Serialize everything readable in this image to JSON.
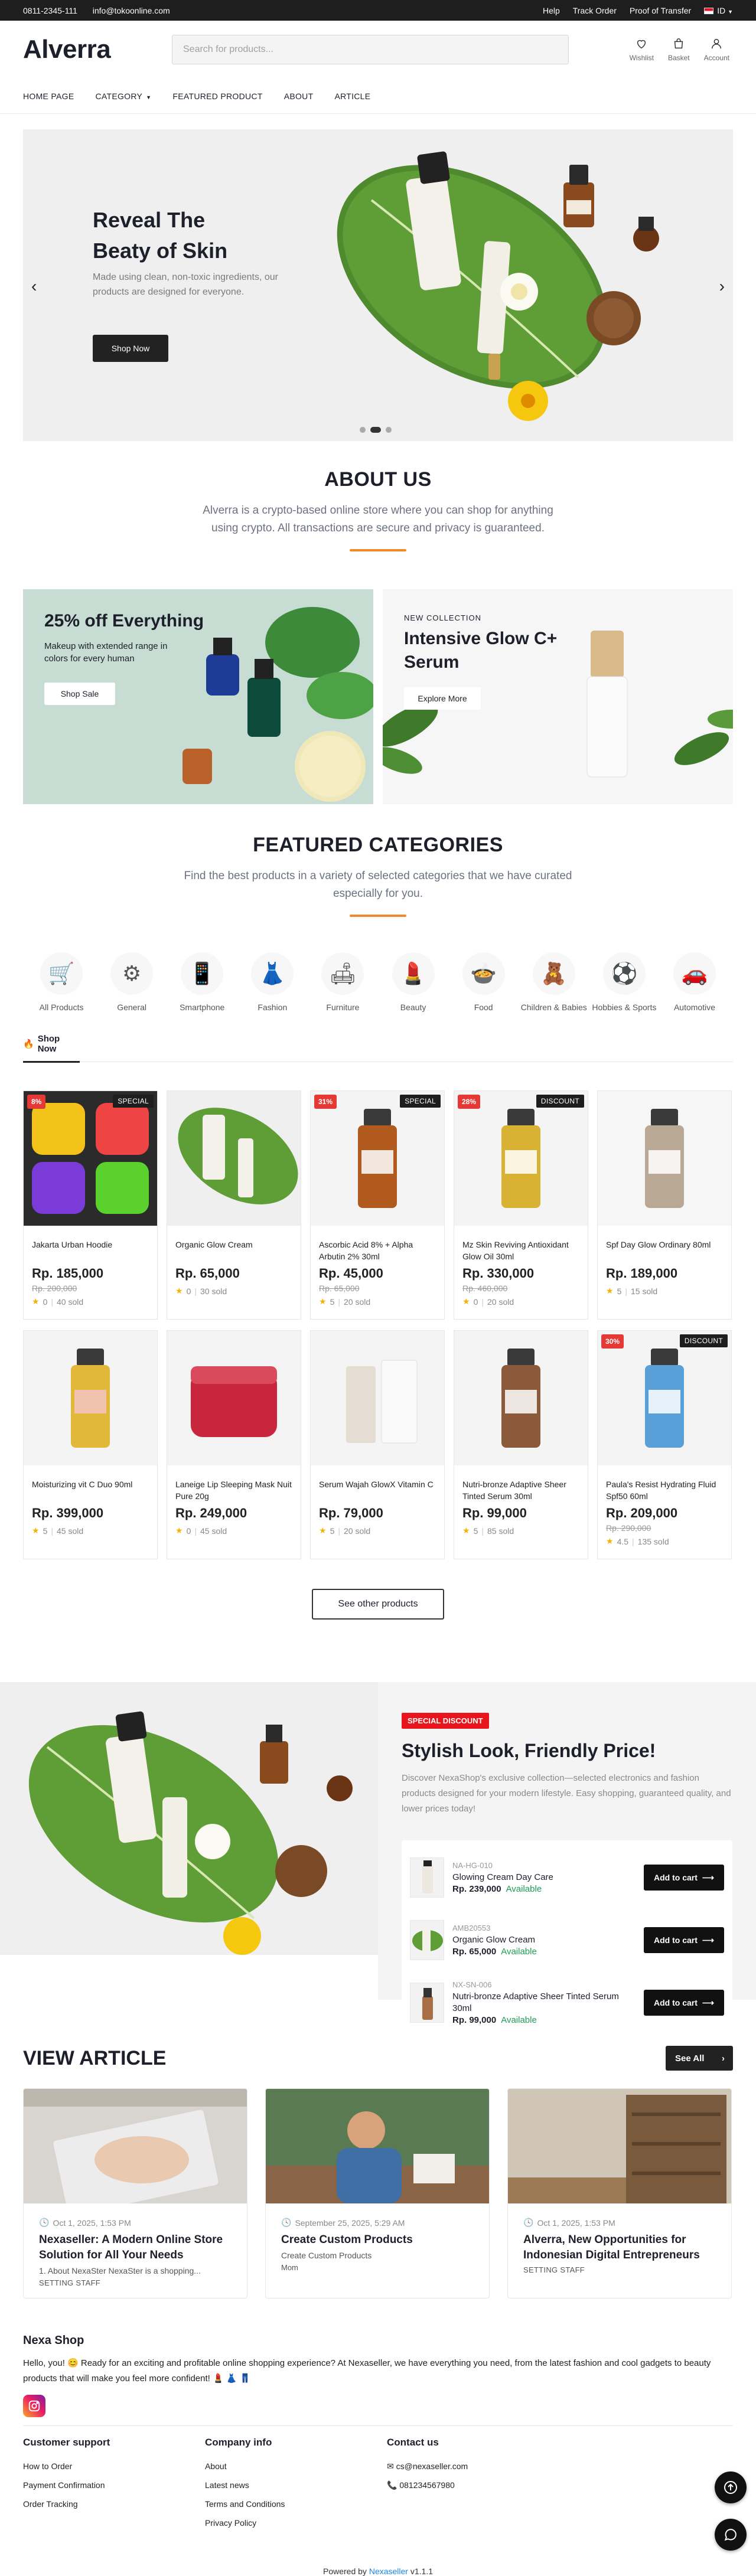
{
  "topbar": {
    "phone": "0811-2345-111",
    "email": "info@tokoonline.com",
    "links": [
      "Help",
      "Track Order",
      "Proof of Transfer"
    ],
    "lang": "ID"
  },
  "header": {
    "logo": "Alverra",
    "search_placeholder": "Search for products...",
    "icons": [
      {
        "label": "Wishlist",
        "icon": "heart-icon"
      },
      {
        "label": "Basket",
        "icon": "bag-icon"
      },
      {
        "label": "Account",
        "icon": "user-icon"
      }
    ]
  },
  "nav": [
    "HOME PAGE",
    "CATEGORY",
    "FEATURED PRODUCT",
    "ABOUT",
    "ARTICLE"
  ],
  "hero": {
    "title_line1": "Reveal The",
    "title_line2": "Beaty of Skin",
    "desc": "Made using clean, non-toxic ingredients, our products are designed for everyone.",
    "button": "Shop Now",
    "slide_index": 2,
    "slide_count": 3
  },
  "about": {
    "title": "ABOUT US",
    "desc": "Alverra is a crypto-based online store where you can shop for anything using crypto. All transactions are secure and privacy is guaranteed."
  },
  "promos": [
    {
      "title": "25% off Everything",
      "desc": "Makeup with extended range in colors for every human",
      "button": "Shop Sale"
    },
    {
      "eyebrow": "NEW COLLECTION",
      "title": "Intensive Glow C+ Serum",
      "button": "Explore More"
    }
  ],
  "categories": {
    "title": "FEATURED CATEGORIES",
    "desc": "Find the best products in a variety of selected categories that we have curated especially for you.",
    "items": [
      {
        "label": "All Products",
        "icon": "🛒"
      },
      {
        "label": "General",
        "icon": "⚙"
      },
      {
        "label": "Smartphone",
        "icon": "📱"
      },
      {
        "label": "Fashion",
        "icon": "👗"
      },
      {
        "label": "Furniture",
        "icon": "🛋"
      },
      {
        "label": "Beauty",
        "icon": "💄"
      },
      {
        "label": "Food",
        "icon": "🍲"
      },
      {
        "label": "Children & Babies",
        "icon": "🧸"
      },
      {
        "label": "Hobbies & Sports",
        "icon": "⚽"
      },
      {
        "label": "Automotive",
        "icon": "🚗"
      }
    ]
  },
  "shop_tab": "Shop Now",
  "products": [
    {
      "name": "Jakarta Urban Hoodie",
      "price": "Rp. 185,000",
      "old": "Rp. 200,000",
      "rating": "0",
      "sold": "40 sold",
      "pct": "8%",
      "tag": "SPECIAL"
    },
    {
      "name": "Organic Glow Cream",
      "price": "Rp. 65,000",
      "old": "",
      "rating": "0",
      "sold": "30 sold",
      "pct": "",
      "tag": ""
    },
    {
      "name": "Ascorbic Acid 8% + Alpha Arbutin 2% 30ml",
      "price": "Rp. 45,000",
      "old": "Rp. 65,000",
      "rating": "5",
      "sold": "20 sold",
      "pct": "31%",
      "tag": "SPECIAL"
    },
    {
      "name": "Mz Skin Reviving Antioxidant Glow Oil 30ml",
      "price": "Rp. 330,000",
      "old": "Rp. 460,000",
      "rating": "0",
      "sold": "20 sold",
      "pct": "28%",
      "tag": "DISCOUNT"
    },
    {
      "name": "Spf Day Glow Ordinary 80ml",
      "price": "Rp. 189,000",
      "old": "",
      "rating": "5",
      "sold": "15 sold",
      "pct": "",
      "tag": ""
    },
    {
      "name": "Moisturizing vit C Duo 90ml",
      "price": "Rp. 399,000",
      "old": "",
      "rating": "5",
      "sold": "45 sold",
      "pct": "",
      "tag": ""
    },
    {
      "name": "Laneige Lip Sleeping Mask Nuit Pure 20g",
      "price": "Rp. 249,000",
      "old": "",
      "rating": "0",
      "sold": "45 sold",
      "pct": "",
      "tag": ""
    },
    {
      "name": "Serum Wajah GlowX Vitamin C",
      "price": "Rp. 79,000",
      "old": "",
      "rating": "5",
      "sold": "20 sold",
      "pct": "",
      "tag": ""
    },
    {
      "name": "Nutri-bronze Adaptive Sheer Tinted Serum 30ml",
      "price": "Rp. 99,000",
      "old": "",
      "rating": "5",
      "sold": "85 sold",
      "pct": "",
      "tag": ""
    },
    {
      "name": "Paula's Resist Hydrating Fluid Spf50 60ml",
      "price": "Rp. 209,000",
      "old": "Rp. 290,000",
      "rating": "4.5",
      "sold": "135 sold",
      "pct": "30%",
      "tag": "DISCOUNT"
    }
  ],
  "see_other": "See other products",
  "special": {
    "badge": "SPECIAL DISCOUNT",
    "title": "Stylish Look, Friendly Price!",
    "desc": "Discover NexaShop's exclusive collection—selected electronics and fashion products designed for your modern lifestyle. Easy shopping, guaranteed quality, and lower prices today!",
    "items": [
      {
        "code": "NA-HG-010",
        "name": "Glowing Cream Day Care",
        "price": "Rp. 239,000",
        "avail": "Available",
        "button": "Add to cart"
      },
      {
        "code": "AMB20553",
        "name": "Organic Glow Cream",
        "price": "Rp. 65,000",
        "avail": "Available",
        "button": "Add to cart"
      },
      {
        "code": "NX-SN-006",
        "name": "Nutri-bronze Adaptive Sheer Tinted Serum 30ml",
        "price": "Rp. 99,000",
        "avail": "Available",
        "button": "Add to cart"
      }
    ]
  },
  "articles": {
    "title": "VIEW ARTICLE",
    "see_all": "See All",
    "items": [
      {
        "date": "Oct 1, 2025, 1:53 PM",
        "title": "Nexaseller: A Modern Online Store Solution for All Your Needs",
        "sub": "1. About NexaSter NexaSter is a shopping...",
        "author": "SETTING STAFF"
      },
      {
        "date": "September 25, 2025, 5:29 AM",
        "title": "Create Custom Products",
        "sub": "Create Custom Products",
        "author": "Mom"
      },
      {
        "date": "Oct 1, 2025, 1:53 PM",
        "title": "Alverra, New Opportunities for Indonesian Digital Entrepreneurs",
        "sub": "",
        "author": "SETTING STAFF"
      }
    ]
  },
  "footer": {
    "shop_name": "Nexa Shop",
    "desc": "Hello, you! 😊 Ready for an exciting and profitable online shopping experience? At Nexaseller, we have everything you need, from the latest fashion and cool gadgets to beauty products that will make you feel more confident! 💄 👗 👖",
    "col1": {
      "title": "Customer support",
      "links": [
        "How to Order",
        "Payment Confirmation",
        "Order Tracking"
      ]
    },
    "col2": {
      "title": "Company info",
      "links": [
        "About",
        "Latest news",
        "Terms and Conditions",
        "Privacy Policy"
      ]
    },
    "col3": {
      "title": "Contact us",
      "email": "cs@nexaseller.com",
      "phone": "081234567980"
    },
    "powered_prefix": "Powered by",
    "powered_brand": "Nexaseller",
    "version": "v1.1.1"
  },
  "colors": {
    "accent": "#f08b2d",
    "dark": "#1e1e1e",
    "sale": "#e53935",
    "available": "#1f9d55"
  }
}
